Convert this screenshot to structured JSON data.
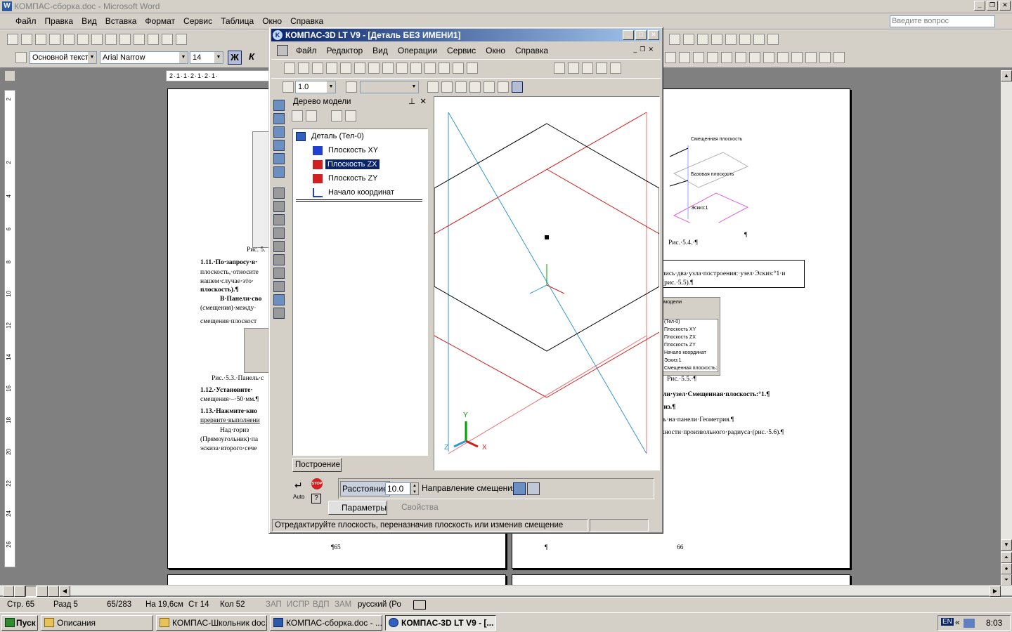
{
  "word": {
    "title": "КОМПАС-сборка.doc - Microsoft Word",
    "menu": [
      "Файл",
      "Правка",
      "Вид",
      "Вставка",
      "Формат",
      "Сервис",
      "Таблица",
      "Окно",
      "Справка"
    ],
    "help_placeholder": "Введите вопрос",
    "style_combo": "Основной текст",
    "font_combo": "Arial Narrow",
    "size_combo": "14",
    "bold_btn": "Ж",
    "italic_btn": "К",
    "ruler_text": "2·1·1·2·1·2·1·",
    "vruler_nums": [
      "2",
      "2",
      "4",
      "6",
      "8",
      "10",
      "12",
      "14",
      "16",
      "18",
      "20",
      "22",
      "24",
      "26"
    ],
    "left_page": {
      "fig1_caption": "Рис. 5.",
      "p1": "1.11.·По·запросу·в·",
      "p1b": "плоскость,·относите",
      "p1c": "нашем·случае·это·",
      "p1d": "плоскость).¶",
      "p2": "В·Панели·сво",
      "p2b": "(смещения)·между·",
      "p2c": "смещения·плоскост",
      "fig2_caption": "Рис.·5.3.·Панель·с",
      "p3": "1.12.·Установите·",
      "p3b": "смещения·–·50·мм.¶",
      "p4": "1.13.·Нажмите·кно",
      "p4b": "прервите·выполнени",
      "p5": "Над·гориз",
      "p5b": "(Прямоугольник)·па",
      "p5c": "эскиза·второго·сече",
      "page_num": "¶65"
    },
    "right_page": {
      "label_shifted": "Смещенная плоскость",
      "label_base": "Базовая плоскость",
      "label_sketch": "Эскиз:1",
      "fig_caption": "Рис.·5.4.·¶",
      "pilcrow": "¶",
      "box_text": "лись·два·узла·построения:·узел·Эскиз:°1·и",
      "box_text2": "(рис.·5.5).¶",
      "mini_tree_title": "модели",
      "mini_tree_items": [
        "(Тел-0)",
        "Плоскость XY",
        "Плоскость ZX",
        "Плоскость ZY",
        "Начало координат",
        "Эскиз:1",
        "Смещенная плоскость:"
      ],
      "fig2_caption": "Рис.·5.5.·¶",
      "t1": "ели·узел·Смещенная·плоскость:°1.¶",
      "t2": "низ.¶",
      "t3": "ль·на·панели·Геометрия.¶",
      "t4": "жности·произвольного·радиуса·(рис.·5.6).¶",
      "page_pilcrow": "¶",
      "page_num": "66"
    },
    "status": {
      "page": "Стр. 65",
      "section": "Разд 5",
      "count": "65/283",
      "at": "На 19,6см",
      "line": "Ст 14",
      "col": "Кол 52",
      "rec": "ЗАП",
      "trk": "ИСПР",
      "ext": "ВДП",
      "ovr": "ЗАМ",
      "lang": "русский (Ро"
    }
  },
  "kompas": {
    "title": "КОМПАС-3D LT V9 - [Деталь БЕЗ ИМЕНИ1]",
    "menu": [
      "Файл",
      "Редактор",
      "Вид",
      "Операции",
      "Сервис",
      "Окно",
      "Справка"
    ],
    "scale_value": "1.0",
    "tree_title": "Дерево модели",
    "tree_items": [
      {
        "label": "Деталь (Тел-0)",
        "color": "#3060c0"
      },
      {
        "label": "Плоскость XY",
        "color": "#2040d0"
      },
      {
        "label": "Плоскость ZX",
        "color": "#d02020"
      },
      {
        "label": "Плоскость ZY",
        "color": "#d02020"
      },
      {
        "label": "Начало координат",
        "color": "#2040d0"
      }
    ],
    "tree_tab": "Построение",
    "prop_distance_label": "Расстояние",
    "prop_distance_value": "10.0",
    "prop_direction_label": "Направление смещения",
    "tab_params": "Параметры",
    "tab_props": "Свойства",
    "stop_label": "STOP",
    "auto_label": "Auto",
    "status_text": "Отредактируйте плоскость, переназначив плоскость или изменив смещение",
    "axis_x": "X",
    "axis_y": "Y",
    "axis_z": "Z",
    "colors": {
      "plane_blue": "#3399cc",
      "plane_red": "#d02020",
      "plane_pink": "#e87070",
      "black_plane": "#000000",
      "axis_green": "#00a000"
    }
  },
  "taskbar": {
    "start": "Пуск",
    "tasks": [
      "Описания",
      "КОМПАС-Школьник doc...",
      "КОМПАС-сборка.doc - ...",
      "КОМПАС-3D LT V9 - [..."
    ],
    "lang": "EN",
    "clock": "8:03"
  }
}
